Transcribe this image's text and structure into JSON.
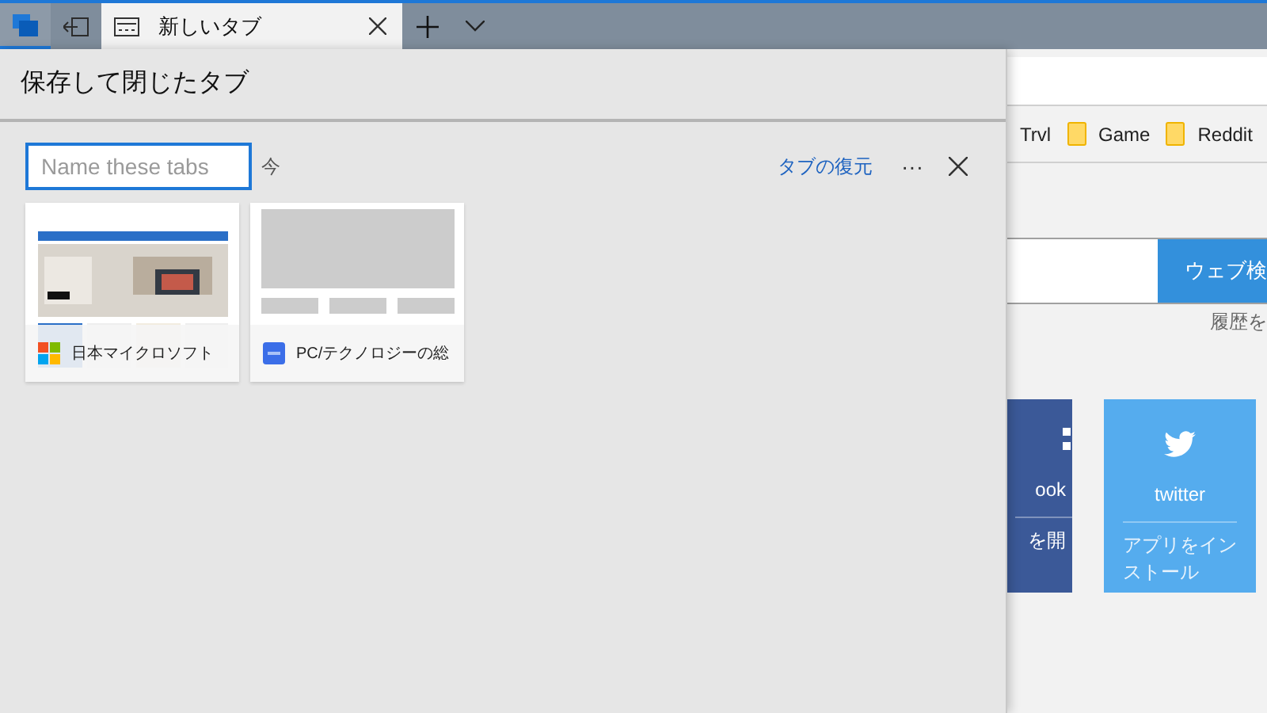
{
  "tab_bar": {
    "tabs": [
      {
        "title": "新しいタブ",
        "selected": true
      }
    ]
  },
  "panel": {
    "title": "保存して閉じたタブ",
    "groups": [
      {
        "name_field": {
          "placeholder": "Name these tabs"
        },
        "time": "今",
        "restore_link": "タブの復元",
        "more": "···",
        "tabs": [
          {
            "title": "日本マイクロソフト",
            "kind": "picture"
          },
          {
            "title": "PC/テクノロジーの総",
            "kind": "placeholder"
          }
        ]
      }
    ]
  },
  "background_page": {
    "favorites": [
      {
        "label": "Trvl",
        "folder": false
      },
      {
        "label": "Game",
        "folder": true
      },
      {
        "label": "Reddit",
        "folder": true
      }
    ],
    "search_button": "ウェブ検",
    "history_link": "履歴を",
    "tiles": [
      {
        "kind": "partial",
        "name": "ook",
        "action": "を開",
        "color": "#3b5998"
      },
      {
        "kind": "full",
        "name": "twitter",
        "action": "アプリをインストール",
        "color": "#55acee"
      }
    ]
  }
}
